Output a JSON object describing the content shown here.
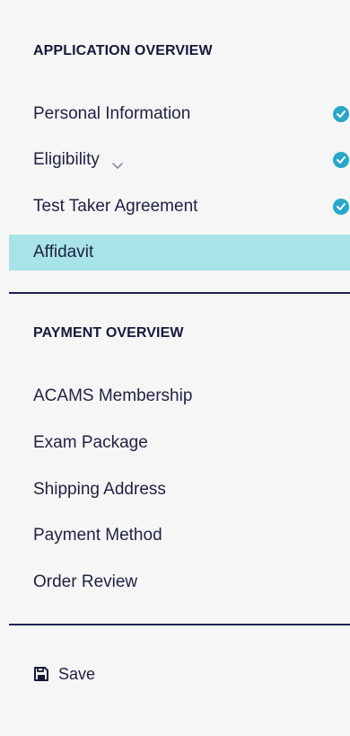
{
  "application_overview": {
    "title": "APPLICATION OVERVIEW",
    "items": [
      {
        "label": "Personal Information",
        "completed": true
      },
      {
        "label": "Eligibility",
        "completed": true,
        "has_dropdown": true
      },
      {
        "label": "Test Taker Agreement",
        "completed": true
      },
      {
        "label": "Affidavit",
        "completed": false,
        "active": true
      }
    ]
  },
  "payment_overview": {
    "title": "PAYMENT OVERVIEW",
    "items": [
      {
        "label": "ACAMS Membership"
      },
      {
        "label": "Exam Package"
      },
      {
        "label": "Shipping Address"
      },
      {
        "label": "Payment Method"
      },
      {
        "label": "Order Review"
      }
    ]
  },
  "actions": {
    "save_label": "Save",
    "save_icon": "floppy-disk-icon"
  },
  "colors": {
    "active_background": "#a8e3e7",
    "check_badge": "#2aa6c6",
    "divider": "#1d2354",
    "text": "#1f2240"
  }
}
